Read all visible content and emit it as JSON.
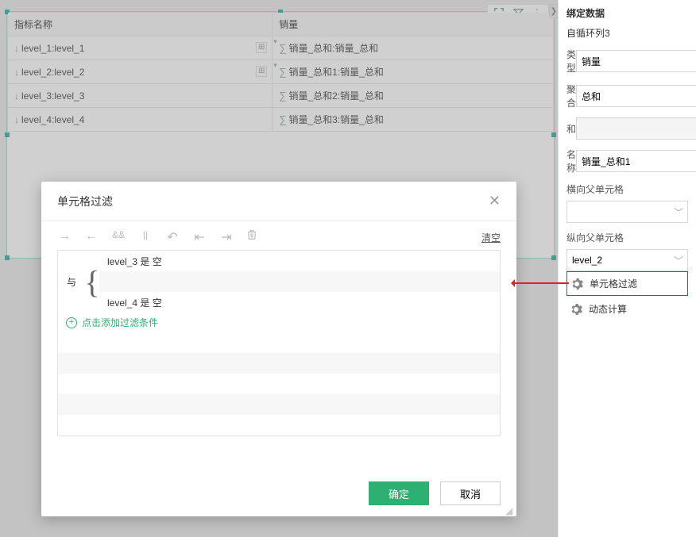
{
  "table": {
    "headers": [
      "指标名称",
      "销量"
    ],
    "rows": [
      {
        "a": "level_1:level_1",
        "b": "销量_总和:销量_总和"
      },
      {
        "a": "level_2:level_2",
        "b": "销量_总和1:销量_总和"
      },
      {
        "a": "level_3:level_3",
        "b": "销量_总和2:销量_总和"
      },
      {
        "a": "level_4:level_4",
        "b": "销量_总和3:销量_总和"
      }
    ],
    "selected_row": 1
  },
  "side": {
    "title": "绑定数据",
    "hint": "自循环列3",
    "type_label": "类型",
    "type_value": "销量",
    "agg_label": "聚合",
    "agg_value": "总和",
    "and_label": "和",
    "and_value": "",
    "name_label": "名称",
    "name_value": "销量_总和1",
    "hparent_label": "横向父单元格",
    "hparent_value": "",
    "vparent_label": "纵向父单元格",
    "vparent_value": "level_2",
    "cell_filter": "单元格过滤",
    "dyn_calc": "动态计算"
  },
  "modal": {
    "title": "单元格过滤",
    "clear": "清空",
    "group_op": "与",
    "cond1": "level_3 是 空",
    "cond2": "level_4 是 空",
    "add": "点击添加过滤条件",
    "ok": "确定",
    "cancel": "取消"
  }
}
